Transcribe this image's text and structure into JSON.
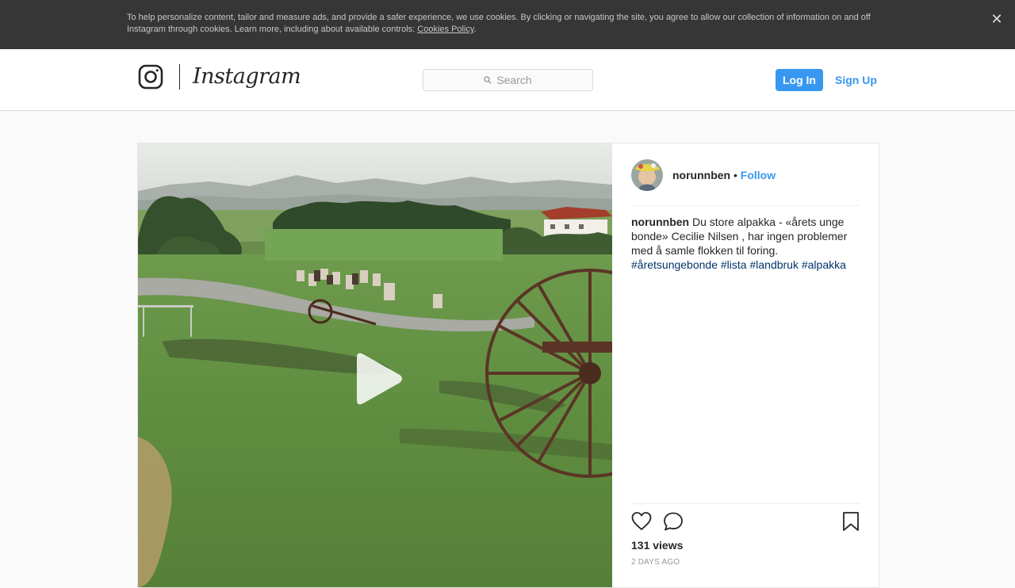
{
  "cookie_banner": {
    "text": "To help personalize content, tailor and measure ads, and provide a safer experience, we use cookies. By clicking or navigating the site, you agree to allow our collection of information on and off Instagram through cookies. Learn more, including about available controls: ",
    "link_label": "Cookies Policy",
    "link_suffix": ".",
    "close_label": "✕"
  },
  "header": {
    "brand": "Instagram",
    "search_placeholder": "Search",
    "login_label": "Log In",
    "signup_label": "Sign Up"
  },
  "post": {
    "author": "norunnben",
    "separator": " • ",
    "follow_label": "Follow",
    "caption_user": "norunnben",
    "caption_text": " Du store alpakka - «årets unge bonde» Cecilie Nilsen , har ingen problemer med å samle flokken til foring.",
    "hashtags": [
      "#åretsungebonde",
      "#lista",
      "#landbruk",
      "#alpakka"
    ],
    "views": "131 views",
    "time_ago": "2 DAYS AGO"
  },
  "colors": {
    "accent": "#3897f0",
    "hashtag": "#003569",
    "banner_bg": "#363636"
  },
  "icons": {
    "close": "close-icon",
    "camera": "instagram-camera-icon",
    "search": "search-icon",
    "play": "play-icon",
    "like": "heart-icon",
    "comment": "comment-icon",
    "save": "bookmark-icon"
  }
}
